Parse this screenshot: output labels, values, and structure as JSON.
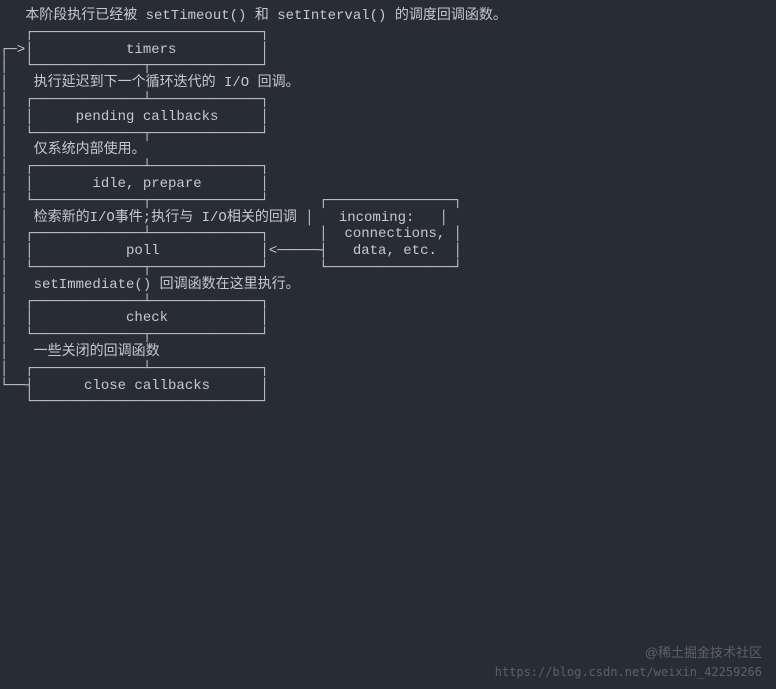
{
  "line01": "   本阶段执行已经被 setTimeout() 和 setInterval() 的调度回调函数。",
  "line02": "   ┌───────────────────────────┐",
  "line03": "┌─>│           timers          │",
  "line04": "│  └─────────────┬─────────────┘",
  "line05": "│   执行延迟到下一个循环迭代的 I/O 回调。",
  "line06": "│  ┌─────────────┴─────────────┐",
  "line07": "│  │     pending callbacks     │",
  "line08": "│  └─────────────┬─────────────┘",
  "line09": "│   仅系统内部使用。",
  "line10": "│  ┌─────────────┴─────────────┐",
  "line11": "│  │       idle, prepare       │",
  "line12": "│  └─────────────┬─────────────┘      ┌───────────────┐",
  "line13": "│   检索新的I/O事件;执行与 I/O相关的回调 │   incoming:   │",
  "line14": "│  ┌─────────────┴─────────────┐      │  connections, │",
  "line15": "│  │           poll            │<─────┤   data, etc.  │",
  "line16": "│  └─────────────┬─────────────┘      └───────────────┘",
  "line17": "│   setImmediate() 回调函数在这里执行。",
  "line18": "│  ┌─────────────┴─────────────┐",
  "line19": "│  │           check           │",
  "line20": "│  └─────────────┬─────────────┘",
  "line21": "│   一些关闭的回调函数",
  "line22": "│  ┌─────────────┴─────────────┐",
  "line23": "└──┤      close callbacks      │",
  "line24": "   └───────────────────────────┘",
  "watermark_top": "@稀土掘金技术社区",
  "watermark_bot": "https://blog.csdn.net/weixin_42259266"
}
